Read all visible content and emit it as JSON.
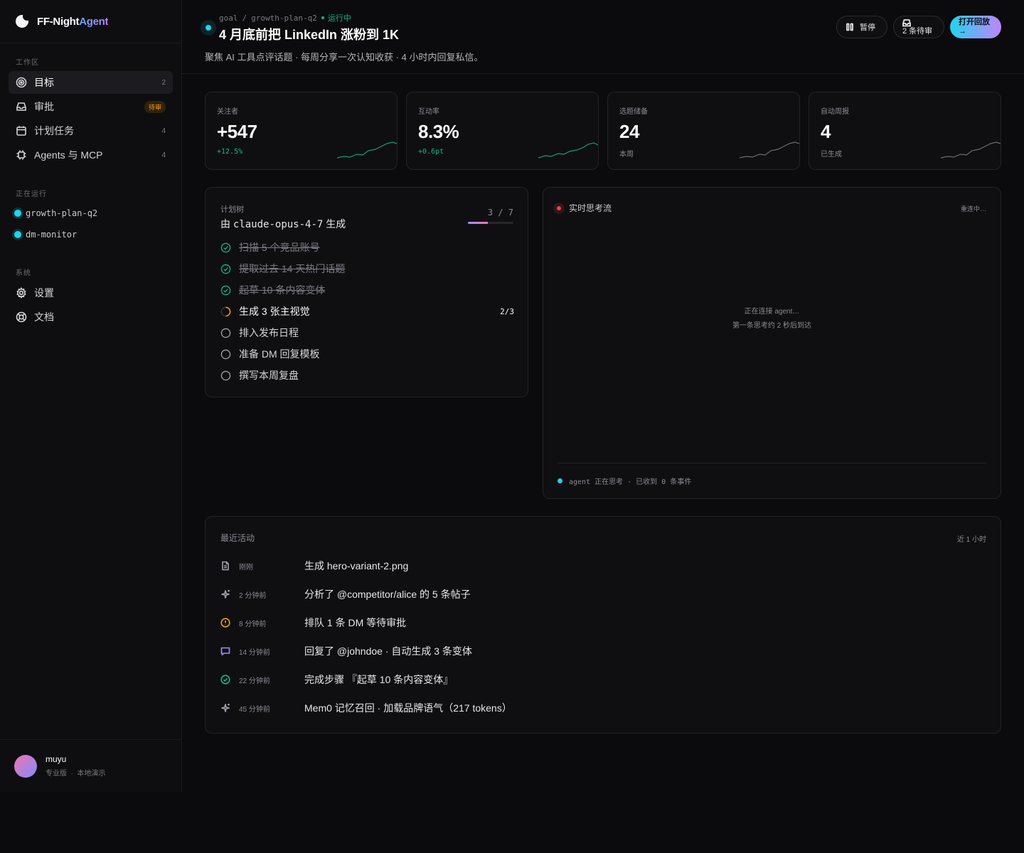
{
  "brand": {
    "name_primary": "FF-Night",
    "name_accent": "Agent"
  },
  "sidebar": {
    "workspace_label": "工作区",
    "items": [
      {
        "label": "目标",
        "count": "2"
      },
      {
        "label": "审批",
        "badge": "待审"
      },
      {
        "label": "计划任务",
        "count": "4"
      },
      {
        "label": "Agents 与 MCP",
        "count": "4"
      }
    ],
    "running_label": "正在运行",
    "running": [
      "growth-plan-q2",
      "dm-monitor"
    ],
    "system_label": "系统",
    "system_items": [
      "设置",
      "文档"
    ],
    "user": {
      "name": "muyu",
      "plan": "专业版",
      "mode": "本地演示"
    }
  },
  "header": {
    "crumb_root": "goal",
    "crumb_sep": "/",
    "crumb_plan": "growth-plan-q2",
    "status": "运行中",
    "title": "4 月底前把 LinkedIn 涨粉到 1K",
    "description": "聚焦 AI 工具点评话题 · 每周分享一次认知收获 · 4 小时内回复私信。",
    "pause_label": "暂停",
    "review_label": "2 条待审",
    "replay_label": "打开回放",
    "replay_arrow": "→"
  },
  "stats": [
    {
      "label": "关注者",
      "value": "+547",
      "sub": "+12.5%"
    },
    {
      "label": "互动率",
      "value": "8.3%",
      "sub": "+0.6pt"
    },
    {
      "label": "选题储备",
      "value": "24",
      "sub": "本周"
    },
    {
      "label": "自动周报",
      "value": "4",
      "sub": "已生成"
    }
  ],
  "plan": {
    "label": "计划树",
    "by_prefix": "由",
    "model": "claude-opus-4-7",
    "by_suffix": "生成",
    "progress_text": "3 / 7",
    "progress": 0.43,
    "steps": [
      {
        "text": "扫描 5 个竞品账号",
        "state": "done"
      },
      {
        "text": "提取过去 14 天热门话题",
        "state": "done"
      },
      {
        "text": "起草 10 条内容变体",
        "state": "done"
      },
      {
        "text": "生成 3 张主视觉",
        "state": "now",
        "count": "2/3"
      },
      {
        "text": "排入发布日程",
        "state": "todo"
      },
      {
        "text": "准备 DM 回复模板",
        "state": "todo"
      },
      {
        "text": "撰写本周复盘",
        "state": "todo"
      }
    ]
  },
  "stream": {
    "label": "实时思考流",
    "state": "重连中…",
    "center_line1": "正在连接 agent…",
    "center_line2": "第一条思考约 2 秒后到达",
    "footer": "agent 正在思考 · 已收到 0 条事件"
  },
  "activity": {
    "label": "最近活动",
    "range": "近 1 小时",
    "rows": [
      {
        "icon": "file-icon",
        "time": "刚刚",
        "text": "生成 hero-variant-2.png"
      },
      {
        "icon": "sparkle-icon",
        "time": "2 分钟前",
        "text": "分析了 @competitor/alice 的 5 条帖子"
      },
      {
        "icon": "alert-icon",
        "time": "8 分钟前",
        "text": "排队 1 条 DM 等待审批"
      },
      {
        "icon": "message-icon",
        "time": "14 分钟前",
        "text": "回复了 @johndoe · 自动生成 3 条变体"
      },
      {
        "icon": "check-circle-icon",
        "time": "22 分钟前",
        "text": "完成步骤 『起草 10 条内容变体』"
      },
      {
        "icon": "sparkle-icon",
        "time": "45 分钟前",
        "text": "Mem0 记忆召回 · 加载品牌语气（217 tokens）"
      }
    ]
  },
  "colors": {
    "accent": "#22d3ee",
    "success": "#10b981",
    "warning": "#f59e0b",
    "danger": "#ef4444",
    "purple": "#a78bfa"
  }
}
